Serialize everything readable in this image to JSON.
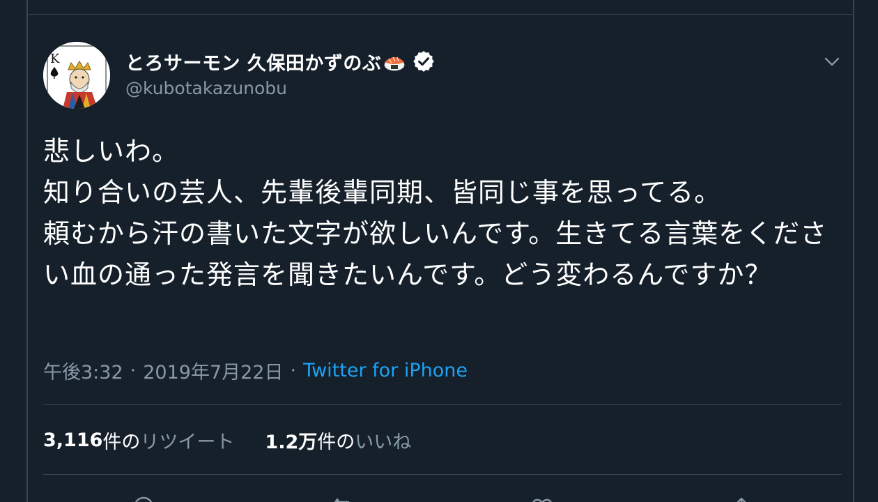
{
  "tweet": {
    "display_name": "とろサーモン 久保田かずのぶ",
    "handle": "@kubotakazunobu",
    "text": "悲しいわ。\n知り合いの芸人、先輩後輩同期、皆同じ事を思ってる。\n頼むから汗の書いた文字が欲しいんです。生きてる言葉をください血の通った発言を聞きたいんです。どう変わるんですか？",
    "time": "午後3:32",
    "date": "2019年7月22日",
    "separator": "·",
    "source": "Twitter for iPhone"
  },
  "stats": {
    "retweets_count": "3,116",
    "retweets_unit": "件の",
    "retweets_label": "リツイート",
    "likes_count": "1.2万",
    "likes_unit": "件の",
    "likes_label": "いいね"
  },
  "icons": {
    "avatar": "king-of-spades-card",
    "sushi": "sushi-icon",
    "verified": "verified-badge-icon",
    "caret": "chevron-down-icon"
  },
  "colors": {
    "background": "#15202b",
    "border": "#38444d",
    "secondary_text": "#8899a6",
    "link": "#1da1f2"
  }
}
